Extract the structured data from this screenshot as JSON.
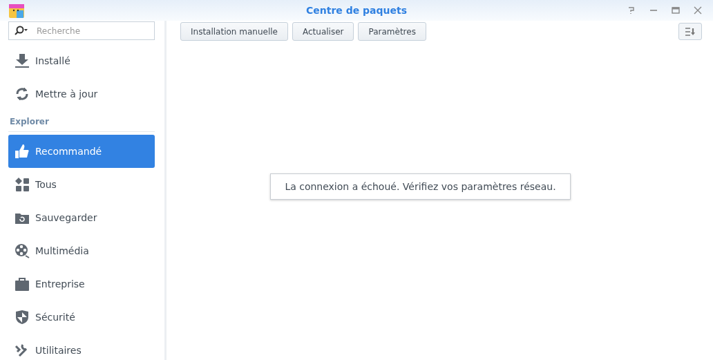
{
  "window": {
    "title": "Centre de paquets"
  },
  "sidebar": {
    "search": {
      "placeholder": "Recherche"
    },
    "items": [
      {
        "label": "Installé",
        "selected": false
      },
      {
        "label": "Mettre à jour",
        "selected": false
      }
    ],
    "section_title": "Explorer",
    "explore_items": [
      {
        "label": "Recommandé",
        "selected": true
      },
      {
        "label": "Tous",
        "selected": false
      },
      {
        "label": "Sauvegarder",
        "selected": false
      },
      {
        "label": "Multimédia",
        "selected": false
      },
      {
        "label": "Entreprise",
        "selected": false
      },
      {
        "label": "Sécurité",
        "selected": false
      },
      {
        "label": "Utilitaires",
        "selected": false
      }
    ]
  },
  "toolbar": {
    "buttons": [
      "Installation manuelle",
      "Actualiser",
      "Paramètres"
    ]
  },
  "message": "La connexion a échoué. Vérifiez vos paramètres réseau."
}
